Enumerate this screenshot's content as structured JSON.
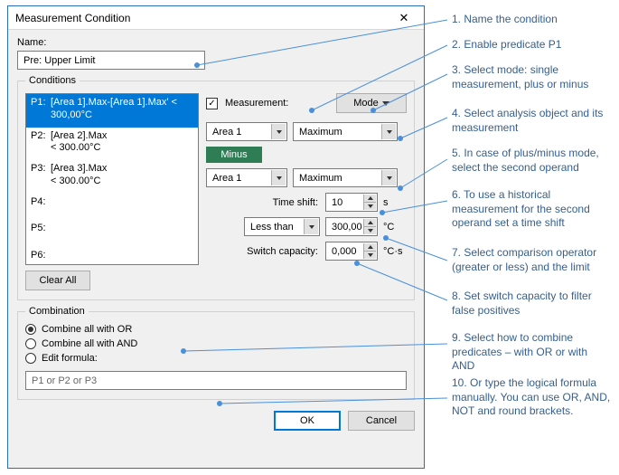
{
  "dialog": {
    "title": "Measurement Condition",
    "name_label": "Name:",
    "name_value": "Pre: Upper Limit",
    "conditions_legend": "Conditions",
    "predicates": [
      {
        "id": "P1:",
        "expr": "[Area 1].Max-[Area 1].Max' < 300,00°C",
        "selected": true
      },
      {
        "id": "P2:",
        "expr": "[Area 2].Max\n< 300.00°C",
        "selected": false
      },
      {
        "id": "P3:",
        "expr": "[Area 3].Max\n< 300.00°C",
        "selected": false
      },
      {
        "id": "P4:",
        "expr": "",
        "selected": false
      },
      {
        "id": "P5:",
        "expr": "",
        "selected": false
      },
      {
        "id": "P6:",
        "expr": "",
        "selected": false
      }
    ],
    "clear_all": "Clear All",
    "measurement_chk": "Measurement:",
    "mode_btn": "Mode",
    "operand1": {
      "object": "Area 1",
      "measure": "Maximum"
    },
    "op_mode": "Minus",
    "operand2": {
      "object": "Area 1",
      "measure": "Maximum"
    },
    "time_shift_label": "Time shift:",
    "time_shift_value": "10",
    "time_shift_unit": "s",
    "comparator": "Less than",
    "limit_value": "300,00",
    "limit_unit": "°C",
    "switch_cap_label": "Switch capacity:",
    "switch_cap_value": "0,000",
    "switch_cap_unit": "°C·s",
    "combination_legend": "Combination",
    "combine_or": "Combine all with OR",
    "combine_and": "Combine all with AND",
    "edit_formula": "Edit formula:",
    "formula_value": "P1 or P2 or P3",
    "ok": "OK",
    "cancel": "Cancel"
  },
  "annotations": [
    "1. Name the condition",
    "2. Enable predicate P1",
    "3. Select mode: single measurement, plus or minus",
    "4. Select analysis object and its measurement",
    "5. In case of plus/minus mode, select the second operand",
    "6. To use a historical measurement for the second operand set a time shift",
    "7. Select comparison operator (greater or less) and the limit",
    "8. Set switch capacity to filter false positives",
    "9. Select how to combine predicates – with OR or with AND",
    "10. Or type the logical formula manually. You can use OR, AND, NOT and round brackets."
  ]
}
